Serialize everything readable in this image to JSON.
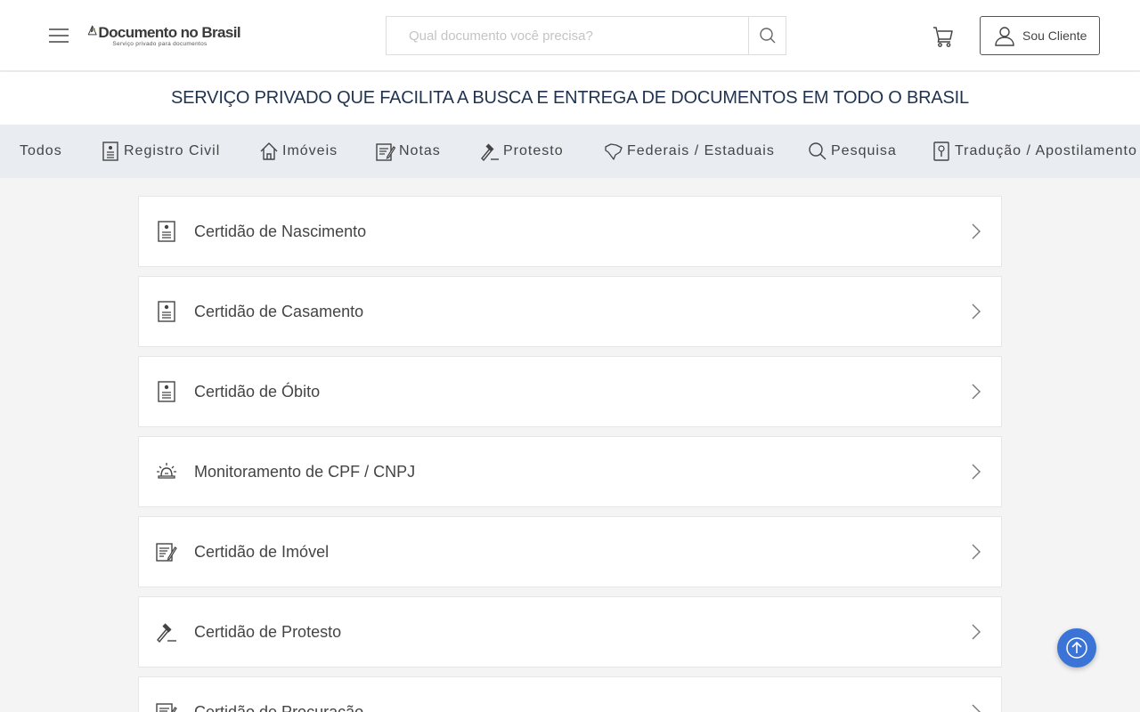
{
  "header": {
    "logo": {
      "title": "Documento no Brasil",
      "subtitle": "Serviço privado para documentos"
    },
    "search": {
      "placeholder": "Qual documento você precisa?",
      "value": ""
    },
    "client_button": "Sou Cliente"
  },
  "banner": "SERVIÇO PRIVADO QUE FACILITA A BUSCA E ENTREGA DE DOCUMENTOS EM TODO O BRASIL",
  "categories": [
    {
      "label": "Todos",
      "icon": "none"
    },
    {
      "label": "Registro Civil",
      "icon": "document-icon"
    },
    {
      "label": "Imóveis",
      "icon": "house-icon"
    },
    {
      "label": "Notas",
      "icon": "notes-icon"
    },
    {
      "label": "Protesto",
      "icon": "gavel-icon"
    },
    {
      "label": "Federais / Estaduais",
      "icon": "brazil-map-icon"
    },
    {
      "label": "Pesquisa",
      "icon": "search-icon"
    },
    {
      "label": "Tradução / Apostilamento",
      "icon": "passport-icon"
    }
  ],
  "items": [
    {
      "label": "Certidão de Nascimento",
      "icon": "document-icon"
    },
    {
      "label": "Certidão de Casamento",
      "icon": "document-icon"
    },
    {
      "label": "Certidão de Óbito",
      "icon": "document-icon"
    },
    {
      "label": "Monitoramento de CPF / CNPJ",
      "icon": "alarm-icon"
    },
    {
      "label": "Certidão de Imóvel",
      "icon": "notes-icon"
    },
    {
      "label": "Certidão de Protesto",
      "icon": "gavel-icon"
    },
    {
      "label": "Certidão de Procuração",
      "icon": "notes-icon"
    }
  ],
  "colors": {
    "accent": "#3b74d6",
    "banner_text": "#1f3350",
    "nav_bg": "#e9ecf0"
  }
}
